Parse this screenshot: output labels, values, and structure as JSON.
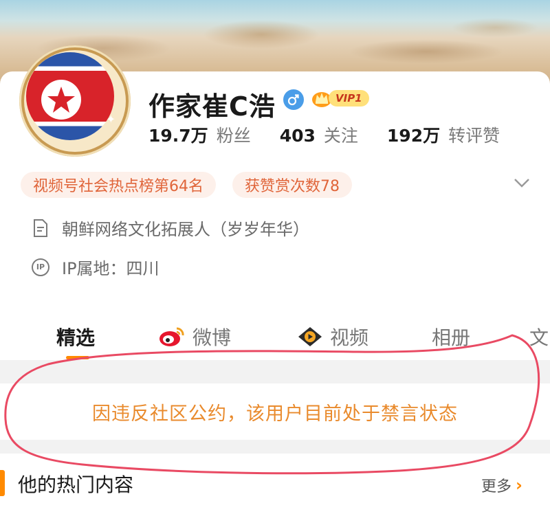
{
  "profile": {
    "name": "作家崔C浩",
    "vip_label": "VIP1",
    "stats": [
      {
        "num": "19.7万",
        "label": "粉丝"
      },
      {
        "num": "403",
        "label": "关注"
      },
      {
        "num": "192万",
        "label": "转评赞"
      }
    ],
    "badges": [
      "视频号社会热点榜第64名",
      "获赞赏次数78"
    ],
    "bio": "朝鲜网络文化拓展人（岁岁年华）",
    "ip_location": "IP属地：四川",
    "ip_icon_text": "IP"
  },
  "tabs": [
    {
      "label": "精选",
      "active": true
    },
    {
      "label": "微博",
      "icon": "weibo-icon"
    },
    {
      "label": "视频",
      "icon": "video-icon"
    },
    {
      "label": "相册"
    },
    {
      "label": "文"
    }
  ],
  "notice": "因违反社区公约，该用户目前处于禁言状态",
  "hot_section": {
    "title": "他的热门内容",
    "more": "更多"
  },
  "colors": {
    "accent": "#ff8a00",
    "notice_text": "#e98a2c",
    "pill_text": "#e0653a",
    "pill_bg": "#fdf0ea",
    "annotation": "#e94a63"
  },
  "icons": [
    "flag-avatar",
    "male-icon",
    "vip-crown-icon",
    "chevron-down-icon",
    "document-icon",
    "ip-icon",
    "weibo-icon",
    "video-icon",
    "chevron-right-icon"
  ]
}
